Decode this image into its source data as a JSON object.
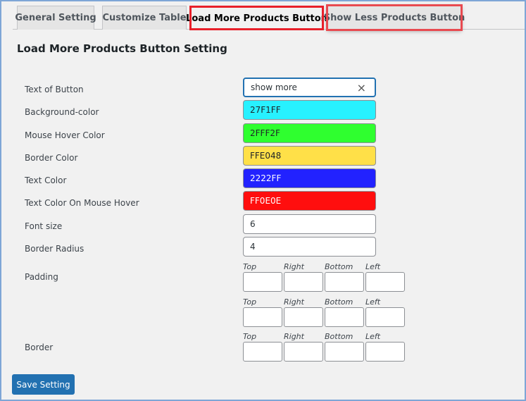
{
  "tabs": [
    "General Setting",
    "Customize Table",
    "Load More Products Button",
    "Show Less Products Button"
  ],
  "heading": "Load More Products Button Setting",
  "fields": [
    {
      "label": "Text of Button",
      "value": "show more"
    },
    {
      "label": "Background-color",
      "value": "27F1FF",
      "bg": "#27F1FF",
      "fg": "#1d2327"
    },
    {
      "label": "Mouse Hover Color",
      "value": "2FFF2F",
      "bg": "#2FFF2F",
      "fg": "#1d2327"
    },
    {
      "label": "Border Color",
      "value": "FFE048",
      "bg": "#FFE048",
      "fg": "#1d2327"
    },
    {
      "label": "Text Color",
      "value": "2222FF",
      "bg": "#2222FF",
      "fg": "#ffffff"
    },
    {
      "label": "Text Color On Mouse Hover",
      "value": "FF0E0E",
      "bg": "#FF0E0E",
      "fg": "#ffffff"
    },
    {
      "label": "Font size",
      "value": "6"
    },
    {
      "label": "Border Radius",
      "value": "4"
    }
  ],
  "padding_label": "Padding",
  "border_label": "Border",
  "sides": [
    "Top",
    "Right",
    "Bottom",
    "Left"
  ],
  "clear_icon": "×",
  "save": "Save Setting"
}
